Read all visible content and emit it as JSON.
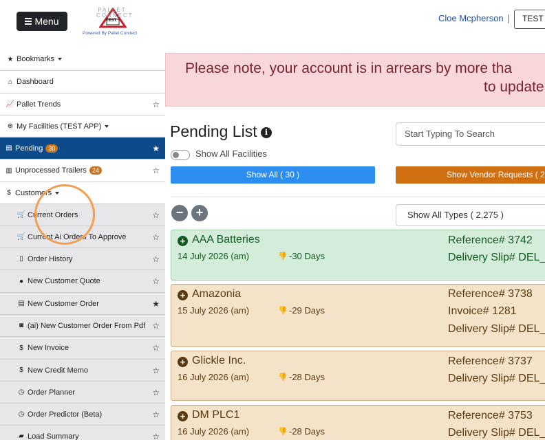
{
  "header": {
    "menu_label": "Menu",
    "logo_top": "PALLET CONNECT",
    "logo_badge": "TEST",
    "logo_powered": "Powered By Pallet Connect",
    "user_name": "Cloe Mcpherson",
    "separator": "|",
    "app_button": "TEST ."
  },
  "sidebar": {
    "items": [
      {
        "label": "Bookmarks",
        "icon": "star-icon"
      },
      {
        "label": "Dashboard",
        "icon": "home-icon"
      },
      {
        "label": "Pallet Trends",
        "icon": "chart-icon"
      },
      {
        "label": "My Facilities (TEST APP)",
        "icon": "globe-icon"
      },
      {
        "label": "Pending",
        "badge": "30",
        "icon": "clipboard-icon"
      },
      {
        "label": "Unprocessed Trailers",
        "badge": "24",
        "icon": "trailer-icon"
      },
      {
        "label": "Customers",
        "icon": "dollar-icon"
      }
    ],
    "sub_items": [
      {
        "label": "Current Orders",
        "icon": "cart-icon"
      },
      {
        "label": "Current Ai Orders To Approve",
        "icon": "cart-icon"
      },
      {
        "label": "Order History",
        "icon": "file-icon"
      },
      {
        "label": "New Customer Quote",
        "icon": "comment-icon"
      },
      {
        "label": "New Customer Order",
        "icon": "list-icon"
      },
      {
        "label": "(ai) New Customer Order From Pdf",
        "icon": "robot-icon"
      },
      {
        "label": "New Invoice",
        "icon": "dollar-icon"
      },
      {
        "label": "New Credit Memo",
        "icon": "dollar-icon"
      },
      {
        "label": "Order Planner",
        "icon": "clock-icon"
      },
      {
        "label": "Order Predictor (Beta)",
        "icon": "clock-icon"
      },
      {
        "label": "Load Summary",
        "icon": "truck-icon"
      }
    ]
  },
  "alert": {
    "line1": "Please note, your account is in arrears by more tha",
    "line2": "to update"
  },
  "pending": {
    "title": "Pending List",
    "toggle_label": "Show All Facilities",
    "search_placeholder": "Start Typing To Search",
    "show_all_button": "Show All ( 30 )",
    "vendor_button": "Show Vendor Requests ( 2",
    "types_select": "Show All Types ( 2,275 )",
    "minus": "−",
    "plus": "+"
  },
  "cards": [
    {
      "name": "AAA Batteries",
      "date": "14 July 2026 (am)",
      "days": "-30 Days",
      "refs": [
        "Reference# 3742",
        "Delivery Slip# DEL_"
      ],
      "color": "#d4edda"
    },
    {
      "name": "Amazonia",
      "date": "15 July 2026 (am)",
      "days": "-29 Days",
      "refs": [
        "Reference# 3738",
        "Invoice# 1281",
        "Delivery Slip# DEL_"
      ],
      "color": "#f5e3c9"
    },
    {
      "name": "Glickle Inc.",
      "date": "16 July 2026 (am)",
      "days": "-28 Days",
      "refs": [
        "Reference# 3737",
        "Delivery Slip# DEL_"
      ],
      "color": "#f5e3c9"
    },
    {
      "name": "DM PLC1",
      "date": "16 July 2026 (am)",
      "days": "-28 Days",
      "refs": [
        "Reference# 3753",
        "Delivery Slip# DEL_"
      ],
      "color": "#f5e3c9"
    }
  ],
  "colors": {
    "active_nav": "#0c4a8a",
    "badge": "#c8741c",
    "blue_button": "#2d8ef0",
    "orange_button": "#d06f12",
    "alert_bg": "#f8d7da"
  }
}
